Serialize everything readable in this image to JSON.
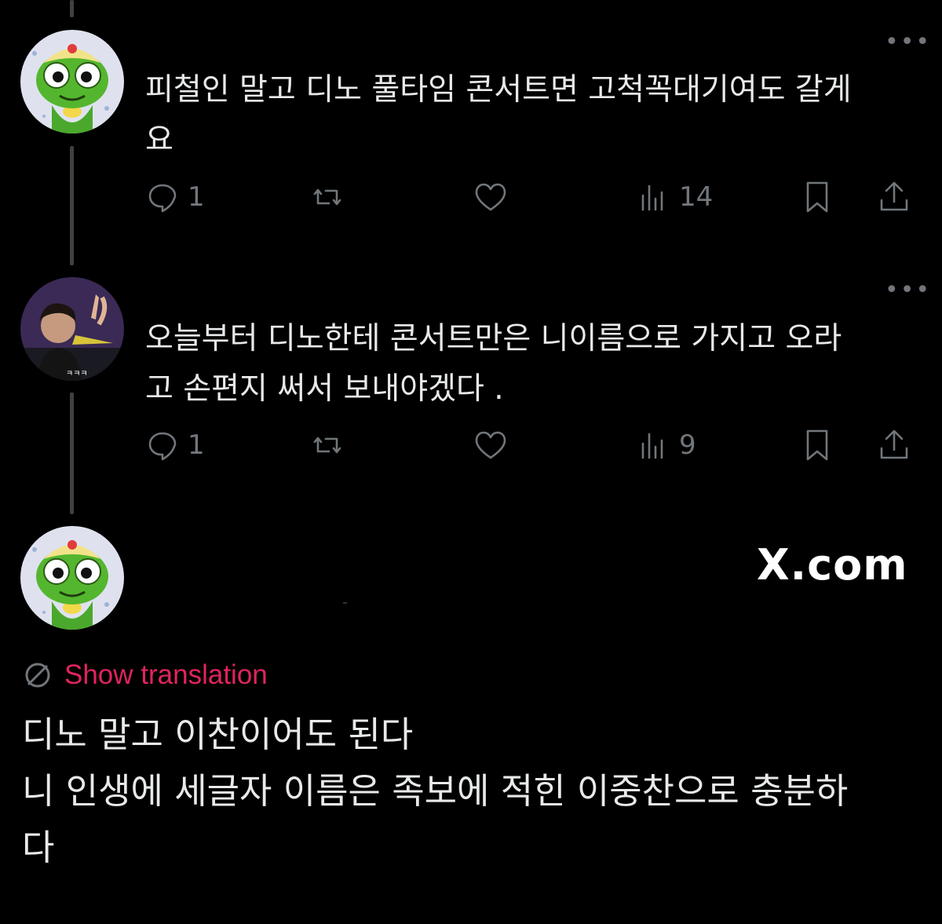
{
  "brand": {
    "label": "X.com"
  },
  "colors": {
    "background": "#000000",
    "text": "#e7e9ea",
    "muted": "#71767b",
    "translation_link": "#e0245e",
    "thread_line": "#3e4144"
  },
  "replies": [
    {
      "avatar_icon": "frog-character-avatar",
      "more_label": "•••",
      "text_lines": [
        "피철인 말고 디노 풀타임 콘서트면 고척꼭대기여도 갈게",
        "요"
      ],
      "reply_count": "1",
      "view_count": "14"
    },
    {
      "avatar_icon": "person-photo-avatar",
      "more_label": "•••",
      "text_lines": [
        "오늘부터 디노한테 콘서트만은 니이름으로 가지고 오라",
        "고 손편지 써서 보내야겠다 ."
      ],
      "reply_count": "1",
      "view_count": "9"
    }
  ],
  "main_post": {
    "avatar_icon": "frog-character-avatar",
    "translate_icon": "globe-icon",
    "translate_label": "Show translation",
    "text_lines": [
      "디노 말고 이찬이어도 된다",
      "니 인생에 세글자 이름은 족보에 적힌 이중찬으로 충분하",
      "다"
    ]
  }
}
